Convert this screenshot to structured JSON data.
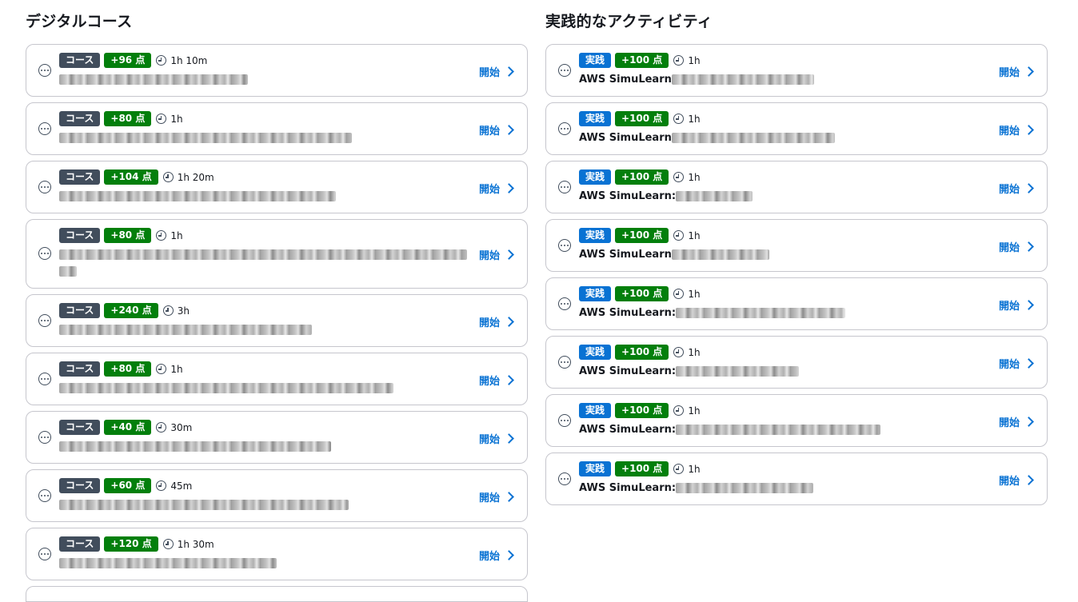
{
  "digital": {
    "title": "デジタルコース",
    "items": [
      {
        "type": "コース",
        "points": "+96 点",
        "duration": "1h 10m",
        "start": "開始"
      },
      {
        "type": "コース",
        "points": "+80 点",
        "duration": "1h",
        "start": "開始"
      },
      {
        "type": "コース",
        "points": "+104 点",
        "duration": "1h 20m",
        "start": "開始"
      },
      {
        "type": "コース",
        "points": "+80 点",
        "duration": "1h",
        "start": "開始"
      },
      {
        "type": "コース",
        "points": "+240 点",
        "duration": "3h",
        "start": "開始"
      },
      {
        "type": "コース",
        "points": "+80 点",
        "duration": "1h",
        "start": "開始"
      },
      {
        "type": "コース",
        "points": "+40 点",
        "duration": "30m",
        "start": "開始"
      },
      {
        "type": "コース",
        "points": "+60 点",
        "duration": "45m",
        "start": "開始"
      },
      {
        "type": "コース",
        "points": "+120 点",
        "duration": "1h 30m",
        "start": "開始"
      }
    ]
  },
  "practice": {
    "title": "実践的なアクティビティ",
    "items": [
      {
        "type": "実践",
        "points": "+100 点",
        "duration": "1h",
        "title_prefix": "AWS SimuLearn",
        "start": "開始"
      },
      {
        "type": "実践",
        "points": "+100 点",
        "duration": "1h",
        "title_prefix": "AWS SimuLearn",
        "start": "開始"
      },
      {
        "type": "実践",
        "points": "+100 点",
        "duration": "1h",
        "title_prefix": "AWS SimuLearn:",
        "start": "開始"
      },
      {
        "type": "実践",
        "points": "+100 点",
        "duration": "1h",
        "title_prefix": "AWS SimuLearn",
        "start": "開始"
      },
      {
        "type": "実践",
        "points": "+100 点",
        "duration": "1h",
        "title_prefix": "AWS SimuLearn:",
        "start": "開始"
      },
      {
        "type": "実践",
        "points": "+100 点",
        "duration": "1h",
        "title_prefix": "AWS SimuLearn:",
        "start": "開始"
      },
      {
        "type": "実践",
        "points": "+100 点",
        "duration": "1h",
        "title_prefix": "AWS SimuLearn:",
        "start": "開始"
      },
      {
        "type": "実践",
        "points": "+100 点",
        "duration": "1h",
        "title_prefix": "AWS SimuLearn:",
        "start": "開始"
      }
    ]
  },
  "colors": {
    "course_badge": "#414d5c",
    "practice_badge": "#0972d3",
    "points_badge": "#037f0c",
    "link": "#0972d3",
    "border": "#c6c6cd"
  },
  "icons": {
    "card_menu": "ellipsis-circle-icon",
    "duration": "clock-icon",
    "start": "chevron-right-icon"
  }
}
